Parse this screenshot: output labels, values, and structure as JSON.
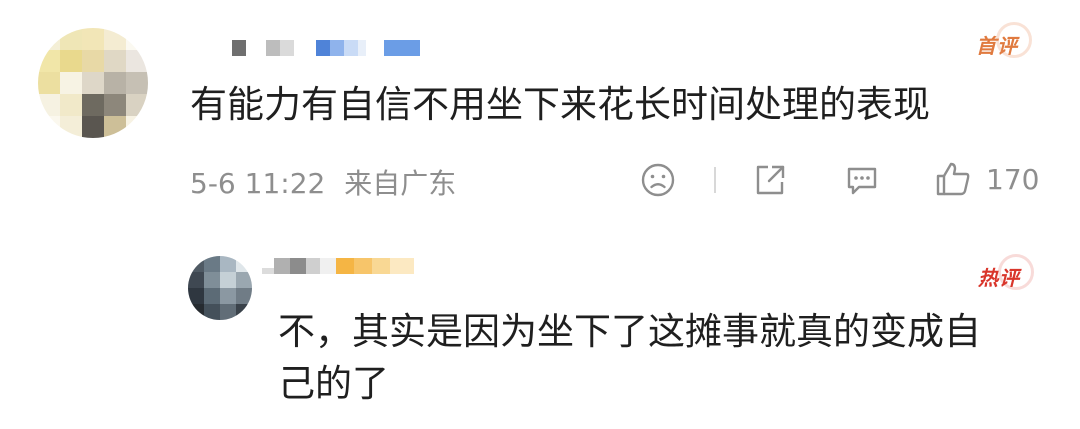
{
  "comment": {
    "badge": "首评",
    "text": "有能力有自信不用坐下来花长时间处理的表现",
    "date": "5-6 11:22",
    "location": "来自广东",
    "like_count": "170",
    "icons": [
      "dislike-face-icon",
      "share-icon",
      "comment-icon",
      "thumb-up-icon"
    ],
    "colors": {
      "badge": "#e07a3f",
      "text": "#1f1f1f",
      "meta": "#8e8e8e"
    }
  },
  "reply": {
    "badge": "热评",
    "text_line1": "不，其实是因为坐下了这摊事就真的变成自",
    "text_line2": "己的了",
    "colors": {
      "badge": "#d9362b"
    }
  }
}
